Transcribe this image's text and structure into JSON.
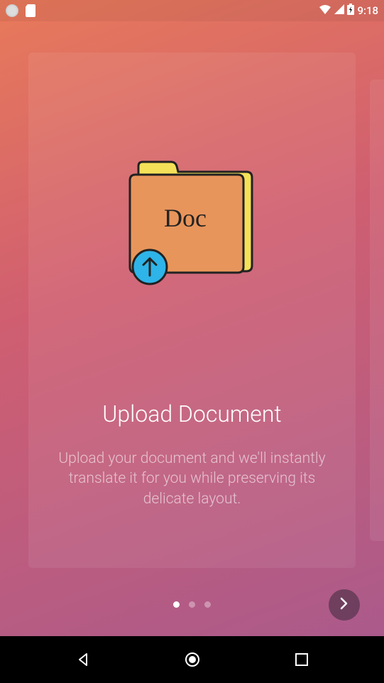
{
  "status_bar": {
    "time": "9:18"
  },
  "card": {
    "illustration": {
      "label": "Doc"
    },
    "heading": "Upload Document",
    "description": "Upload your document and we'll instantly translate it for you while preserving its delicate layout."
  },
  "pagination": {
    "current": 1,
    "total": 3
  }
}
